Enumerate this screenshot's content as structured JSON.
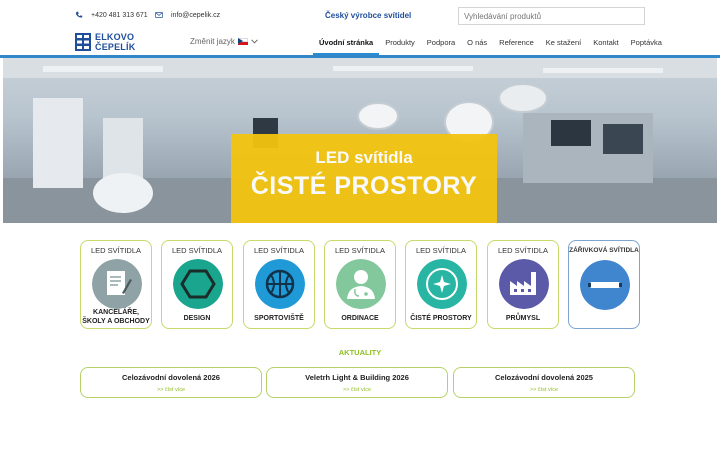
{
  "topbar": {
    "phone": "+420 481 313 671",
    "email": "info@cepelik.cz",
    "maker": "Český výrobce svítidel",
    "search_placeholder": "Vyhledávání produktů"
  },
  "logo": {
    "line1": "ELKOVO",
    "line2": "ČEPELÍK"
  },
  "language": {
    "label": "Změnit jazyk"
  },
  "nav": [
    {
      "label": "Úvodní stránka",
      "active": true
    },
    {
      "label": "Produkty"
    },
    {
      "label": "Podpora"
    },
    {
      "label": "O nás"
    },
    {
      "label": "Reference"
    },
    {
      "label": "Ke stažení"
    },
    {
      "label": "Kontakt"
    },
    {
      "label": "Poptávka"
    }
  ],
  "hero": {
    "line1": "LED svítidla",
    "line2": "ČISTÉ PROSTORY"
  },
  "categories": [
    {
      "title": "LED SVÍTIDLA",
      "label": "KANCELÁŘE, ŠKOLY A OBCHODY",
      "icon": "document-pen-icon",
      "color": "#8fa3a6"
    },
    {
      "title": "LED SVÍTIDLA",
      "label": "DESIGN",
      "icon": "hexagon-icon",
      "color": "#1aa58f"
    },
    {
      "title": "LED SVÍTIDLA",
      "label": "SPORTOVIŠTĚ",
      "icon": "ball-icon",
      "color": "#1f9ad6"
    },
    {
      "title": "LED SVÍTIDLA",
      "label": "ORDINACE",
      "icon": "doctor-icon",
      "color": "#83c79c"
    },
    {
      "title": "LED SVÍTIDLA",
      "label": "ČISTÉ PROSTORY",
      "icon": "clean-room-icon",
      "color": "#29b5a3"
    },
    {
      "title": "LED SVÍTIDLA",
      "label": "PRŮMYSL",
      "icon": "factory-icon",
      "color": "#5a5aa8"
    },
    {
      "title": "ZÁŘIVKOVÁ SVÍTIDLA",
      "label": "",
      "icon": "fluorescent-tube-icon",
      "color": "#3f86cf"
    }
  ],
  "aktuality_heading": "AKTUALITY",
  "news": [
    {
      "title": "Celozávodní dovolená 2026",
      "more": ">> číst více"
    },
    {
      "title": "Veletrh Light & Building 2026",
      "more": ">> číst více"
    },
    {
      "title": "Celozávodní dovolená 2025",
      "more": ">> číst více"
    }
  ],
  "colors": {
    "brand_blue": "#1f4e9b",
    "accent_green": "#8fbf24",
    "banner_yellow": "#f3c40f",
    "nav_underline": "#2a8bd1"
  }
}
